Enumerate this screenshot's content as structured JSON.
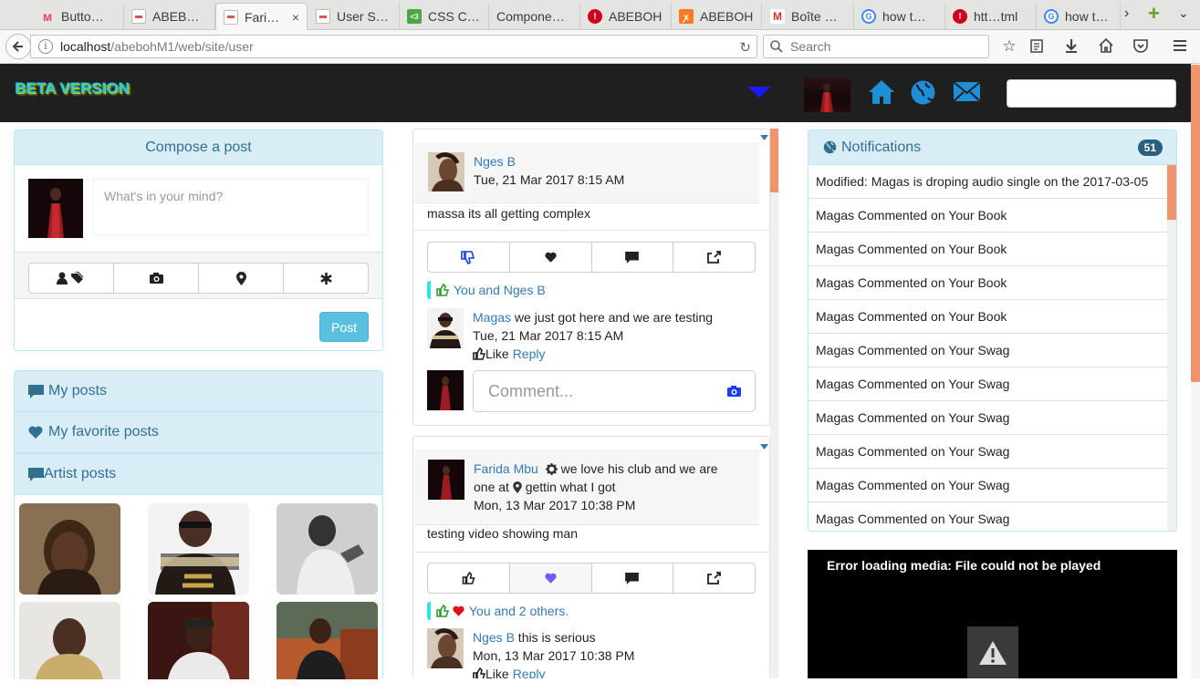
{
  "browser": {
    "tabs": [
      {
        "label": "Butto…",
        "icon": "m-logo-icon",
        "color": "#e04b5a"
      },
      {
        "label": "ABEB…",
        "icon": "page-icon",
        "color": "#d9534f"
      },
      {
        "label": "Fari…",
        "icon": "page-icon",
        "color": "#d9534f",
        "active": true
      },
      {
        "label": "User S…",
        "icon": "page-icon",
        "color": "#d9534f"
      },
      {
        "label": "CSS C…",
        "icon": "css-icon",
        "color": "#4ca646"
      },
      {
        "label": "Compone…",
        "icon": "none",
        "color": ""
      },
      {
        "label": "ABEBOH",
        "icon": "error-icon",
        "color": "#d0021b"
      },
      {
        "label": "ABEBOH",
        "icon": "xampp-icon",
        "color": "#fb7a24"
      },
      {
        "label": "Boîte …",
        "icon": "gmail-icon",
        "color": "#d93025"
      },
      {
        "label": "how t…",
        "icon": "google-icon",
        "color": "#4285f4"
      },
      {
        "label": "htt…tml",
        "icon": "error-icon",
        "color": "#d0021b"
      },
      {
        "label": "how t…",
        "icon": "google-icon",
        "color": "#4285f4"
      }
    ],
    "tab_close": "×",
    "url_host": "localhost",
    "url_path": "/abebohM1/web/site/user",
    "search_placeholder": "Search"
  },
  "app": {
    "brand": "BETA VERSION",
    "accent": "#1e8fd6"
  },
  "compose": {
    "title": "Compose a post",
    "placeholder": "What's in your mind?",
    "post_label": "Post"
  },
  "menu": {
    "my_posts": "My posts",
    "favorites": "My favorite posts",
    "artist_posts": "Artist posts"
  },
  "feed": [
    {
      "name": "Nges B",
      "date": "Tue, 21 Mar 2017 8:15 AM",
      "text": "massa its all getting complex",
      "likes": "You and Nges B",
      "comment": {
        "name": "Magas",
        "text": " we just got here and we are testing",
        "date": "Tue, 21 Mar 2017 8:15 AM",
        "like": "Like",
        "reply": "Reply"
      },
      "comment_placeholder": "Comment..."
    },
    {
      "name": "Farida Mbu",
      "activity_a": " we love his club and we are",
      "activity_b": "one at ",
      "place": " gettin what I got",
      "date": "Mon, 13 Mar 2017 10:38 PM",
      "text": "testing video showing man",
      "likes": "You and 2 others.",
      "comment": {
        "name": "Nges B",
        "text": " this is serious",
        "date": "Mon, 13 Mar 2017 10:38 PM",
        "like": "Like",
        "reply": "Reply"
      }
    }
  ],
  "notifications": {
    "title": "Notifications",
    "count": "51",
    "items": [
      "Modified: Magas is droping audio single on the 2017-03-05",
      "Magas Commented on Your Book",
      "Magas Commented on Your Book",
      "Magas Commented on Your Book",
      "Magas Commented on Your Book",
      "Magas Commented on Your Swag",
      "Magas Commented on Your Swag",
      "Magas Commented on Your Swag",
      "Magas Commented on Your Swag",
      "Magas Commented on Your Swag",
      "Magas Commented on Your Swag"
    ]
  },
  "media": {
    "error": "Error loading media: File could not be played"
  }
}
